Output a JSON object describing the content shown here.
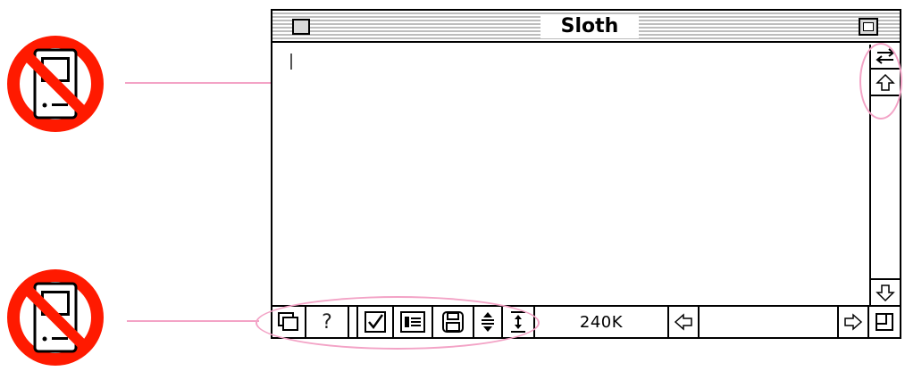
{
  "window": {
    "title": "Sloth",
    "memory_label": "240K",
    "toolbar_help_label": "?"
  },
  "icons": {
    "close_box": "close-box-icon",
    "zoom_box": "zoom-box-icon",
    "swap": "swap-arrows-icon",
    "scroll_up": "arrow-up-icon",
    "scroll_down": "arrow-down-icon",
    "scroll_left": "arrow-left-icon",
    "scroll_right": "arrow-right-icon",
    "no_mac": "no-mac-icon"
  },
  "colors": {
    "highlight": "#f3a3c6",
    "no_sign": "#ff1a00",
    "title_stripes": "#bdbdbd"
  }
}
